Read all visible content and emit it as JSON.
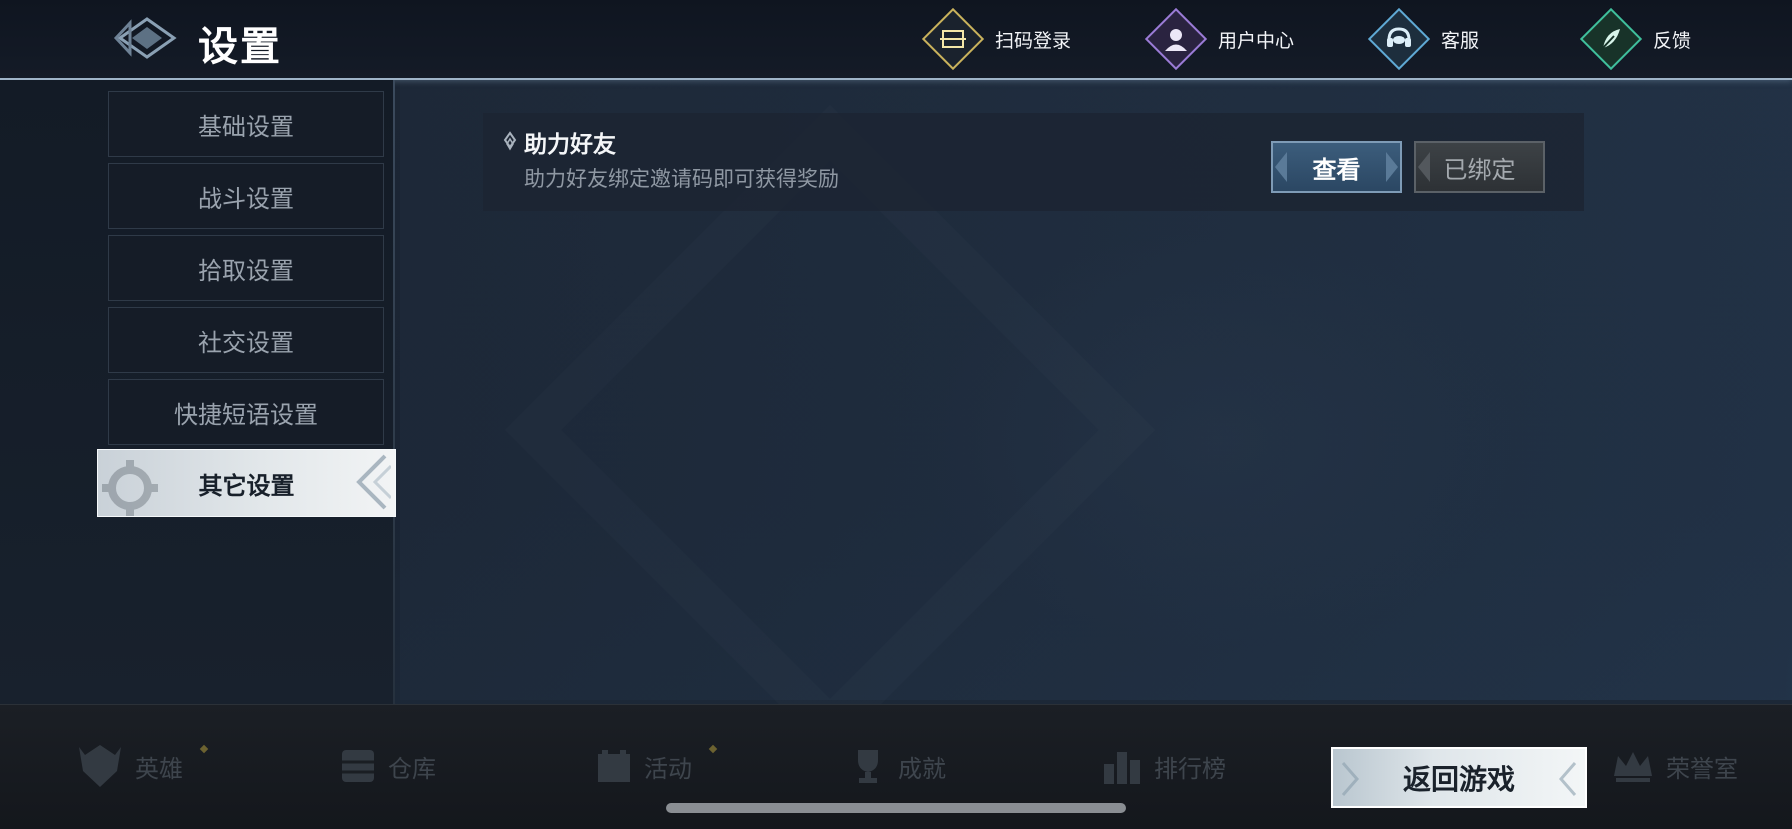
{
  "header": {
    "title": "设置",
    "actions": [
      {
        "label": "扫码登录",
        "icon": "qr-scan-icon",
        "color": "#c9b25c"
      },
      {
        "label": "用户中心",
        "icon": "user-icon",
        "color": "#9a7bd6"
      },
      {
        "label": "客服",
        "icon": "headset-icon",
        "color": "#5fa9d4"
      },
      {
        "label": "反馈",
        "icon": "feather-icon",
        "color": "#3fbf9c"
      }
    ]
  },
  "sidebar": {
    "items": [
      {
        "label": "基础设置"
      },
      {
        "label": "战斗设置"
      },
      {
        "label": "拾取设置"
      },
      {
        "label": "社交设置"
      },
      {
        "label": "快捷短语设置"
      },
      {
        "label": "其它设置",
        "active": true
      }
    ]
  },
  "content": {
    "invite_card": {
      "title": "助力好友",
      "description": "助力好友绑定邀请码即可获得奖励",
      "view_label": "查看",
      "bound_label": "已绑定"
    }
  },
  "bottom_nav": {
    "items": [
      {
        "label": "英雄",
        "icon": "hero-helmet-icon"
      },
      {
        "label": "仓库",
        "icon": "warehouse-icon"
      },
      {
        "label": "活动",
        "icon": "activity-icon"
      },
      {
        "label": "成就",
        "icon": "trophy-icon"
      },
      {
        "label": "排行榜",
        "icon": "ranking-icon"
      },
      {
        "label": "荣誉室",
        "icon": "crown-icon"
      }
    ],
    "return_label": "返回游戏"
  }
}
